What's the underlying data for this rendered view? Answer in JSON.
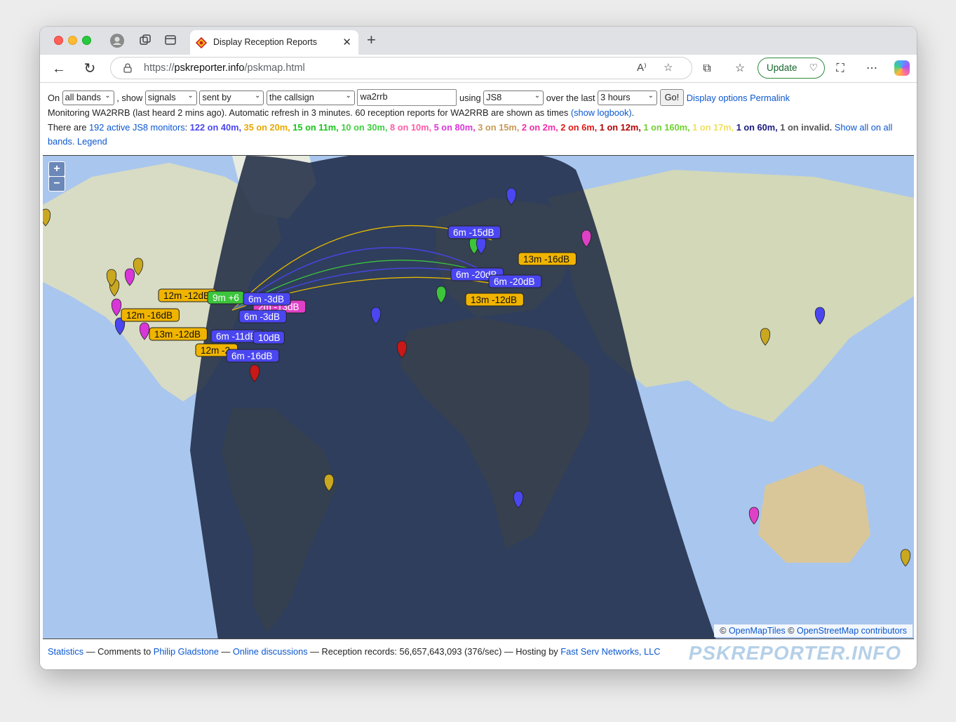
{
  "browser": {
    "tab_title": "Display Reception Reports",
    "url_prefix": "https://",
    "url_host": "pskreporter.info",
    "url_path": "/pskmap.html",
    "update_label": "Update"
  },
  "controls": {
    "on_label": "On",
    "band": "all bands",
    "show_label": ", show",
    "show": "signals",
    "direction": "sent by",
    "target": "the callsign",
    "callsign": "wa2rrb",
    "using_label": "using",
    "mode": "JS8",
    "over_label": "over the last",
    "period": "3 hours",
    "go_label": "Go!",
    "display_options": "Display options",
    "permalink": "Permalink"
  },
  "status": {
    "text": "Monitoring WA2RRB (last heard 2 mins ago). Automatic refresh in 3 minutes. 60 reception reports for WA2RRB are shown as times",
    "show_logbook": "(show logbook)",
    "period": "."
  },
  "monitors": {
    "prefix": "There are",
    "link": "192 active JS8 monitors",
    "colon": ":",
    "bands": [
      {
        "text": "122 on 40m",
        "color": "#4a46f0"
      },
      {
        "text": "35 on 20m",
        "color": "#e6a800"
      },
      {
        "text": "15 on 11m",
        "color": "#19c419"
      },
      {
        "text": "10 on 30m",
        "color": "#40cf40"
      },
      {
        "text": "8 on 10m",
        "color": "#ff5aa8"
      },
      {
        "text": "5 on 80m",
        "color": "#d935d9"
      },
      {
        "text": "3 on 15m",
        "color": "#c99a55"
      },
      {
        "text": "2 on 2m",
        "color": "#ee2ea8"
      },
      {
        "text": "2 on 6m",
        "color": "#e01818"
      },
      {
        "text": "1 on 12m",
        "color": "#b30000"
      },
      {
        "text": "1 on 160m",
        "color": "#70d030"
      },
      {
        "text": "1 on 17m",
        "color": "#f0e060"
      },
      {
        "text": "1 on 60m",
        "color": "#1a1a80"
      },
      {
        "text": "1 on invalid.",
        "color": "#555555"
      }
    ],
    "show_all": "Show all on all bands.",
    "legend": "Legend"
  },
  "map": {
    "zoom_in": "+",
    "zoom_out": "−",
    "attribution_sep": "©",
    "attribution_1": "OpenMapTiles",
    "attribution_2": "OpenStreetMap contributors",
    "labels": [
      {
        "text": "6m -15dB",
        "color": "#4a46f0"
      },
      {
        "text": "13m -16dB",
        "color": "#f0b400"
      },
      {
        "text": "6m -20dB",
        "color": "#4a46f0"
      },
      {
        "text": "6m -20dB",
        "color": "#4a46f0"
      },
      {
        "text": "13m -12dB",
        "color": "#f0b400"
      },
      {
        "text": "12m -12dB",
        "color": "#f0b400"
      },
      {
        "text": "9m +6",
        "color": "#3cc43c"
      },
      {
        "text": "2m -13dB",
        "color": "#e040c8"
      },
      {
        "text": "6m -3dB",
        "color": "#4a46f0"
      },
      {
        "text": "6m -3dB",
        "color": "#4a46f0"
      },
      {
        "text": "12m -16dB",
        "color": "#f0b400"
      },
      {
        "text": "13m -12dB",
        "color": "#f0b400"
      },
      {
        "text": "6m -11dB",
        "color": "#4a46f0"
      },
      {
        "text": "10dB",
        "color": "#4a46f0"
      },
      {
        "text": "12m -2",
        "color": "#f0b400"
      },
      {
        "text": "6m -16dB",
        "color": "#4a46f0"
      }
    ]
  },
  "footer": {
    "statistics": "Statistics",
    "comments": "— Comments to",
    "author": "Philip Gladstone",
    "sep": "—",
    "discussions": "Online discussions",
    "records": "— Reception records: 56,657,643,093 (376/sec) — Hosting by",
    "host": "Fast Serv Networks, LLC",
    "brand": "PSKREPORTER.INFO"
  }
}
